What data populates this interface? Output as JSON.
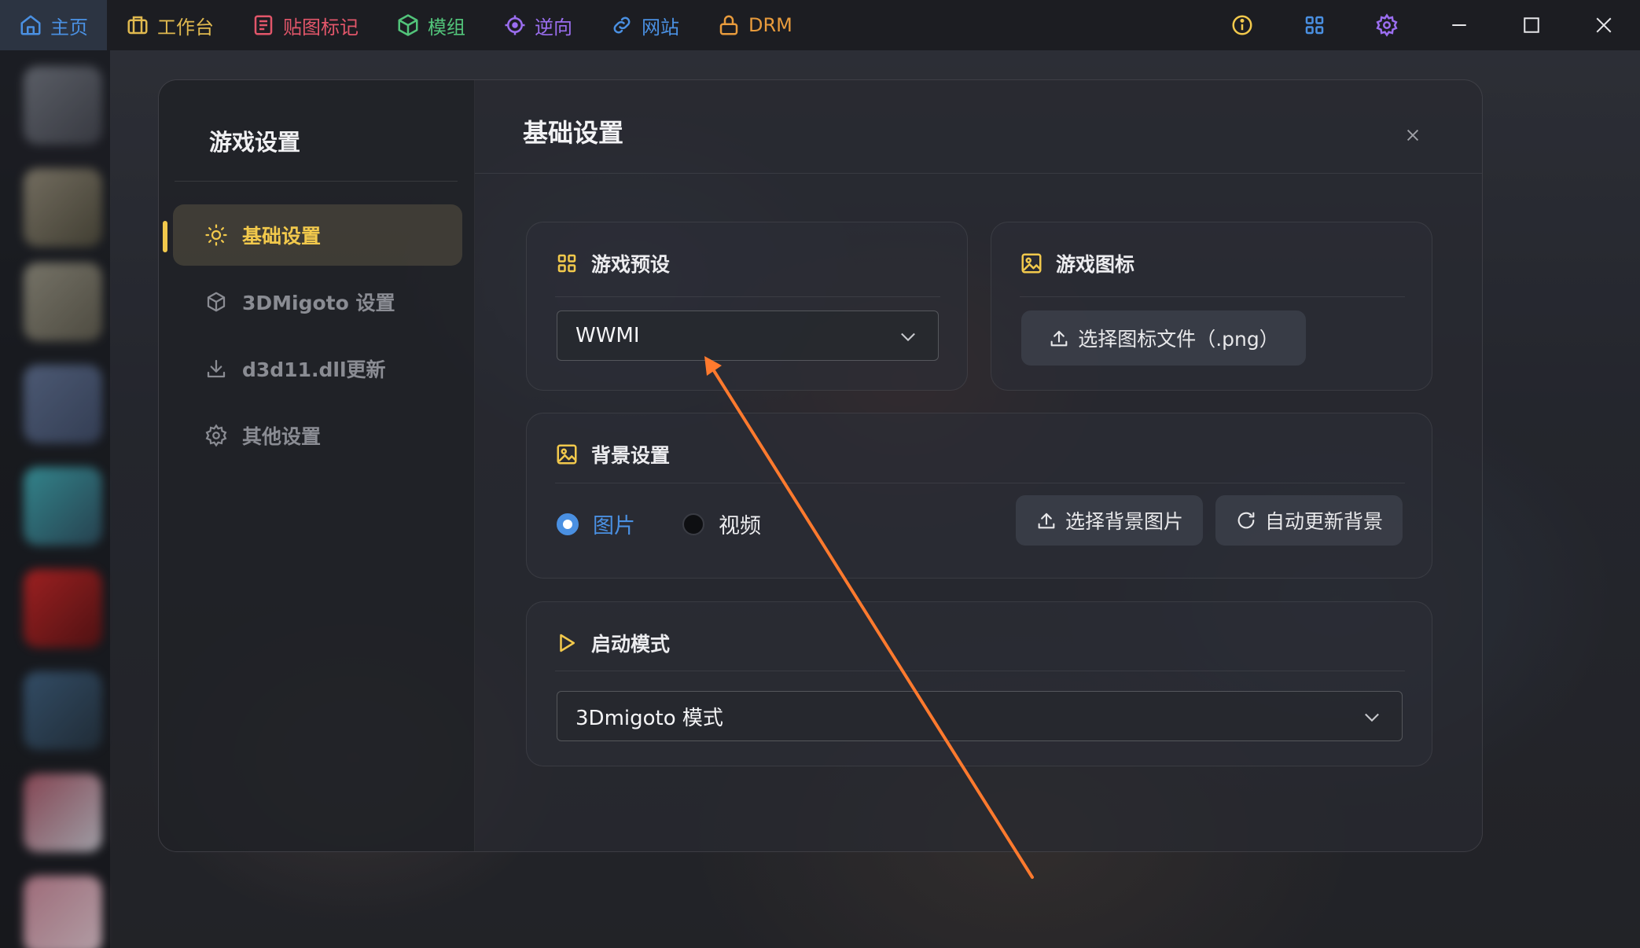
{
  "nav": {
    "items": [
      {
        "label": "主页",
        "icon": "home-icon",
        "color": "#4a90e2"
      },
      {
        "label": "工作台",
        "icon": "briefcase-icon",
        "color": "#e0b94f"
      },
      {
        "label": "贴图标记",
        "icon": "document-list-icon",
        "color": "#e2566a"
      },
      {
        "label": "模组",
        "icon": "cube-icon",
        "color": "#52c47a"
      },
      {
        "label": "逆向",
        "icon": "crosshair-icon",
        "color": "#9b6ef0"
      },
      {
        "label": "网站",
        "icon": "link-icon",
        "color": "#4a90e2"
      },
      {
        "label": "DRM",
        "icon": "lock-icon",
        "color": "#e89b3c"
      }
    ]
  },
  "window": {
    "icons": [
      "info-icon",
      "grid-icon",
      "settings-icon",
      "minimize-icon",
      "maximize-icon",
      "close-icon"
    ]
  },
  "sidebar": {
    "title": "游戏设置",
    "items": [
      {
        "label": "基础设置",
        "icon": "sun-icon",
        "active": true
      },
      {
        "label": "3DMigoto 设置",
        "icon": "box-icon",
        "active": false
      },
      {
        "label": "d3d11.dll更新",
        "icon": "download-icon",
        "active": false
      },
      {
        "label": "其他设置",
        "icon": "gear-icon",
        "active": false
      }
    ]
  },
  "main": {
    "title": "基础设置",
    "preset": {
      "title": "游戏预设",
      "value": "WWMI"
    },
    "game_icon": {
      "title": "游戏图标",
      "button": "选择图标文件（.png）"
    },
    "background": {
      "title": "背景设置",
      "options": [
        {
          "label": "图片",
          "selected": true
        },
        {
          "label": "视频",
          "selected": false
        }
      ],
      "select_button": "选择背景图片",
      "auto_button": "自动更新背景"
    },
    "launch": {
      "title": "启动模式",
      "value": "3Dmigoto 模式"
    }
  },
  "colors": {
    "accent": "#f2c94c",
    "radio_selected": "#4a90e2",
    "annotation_arrow": "#ff7a2e"
  }
}
